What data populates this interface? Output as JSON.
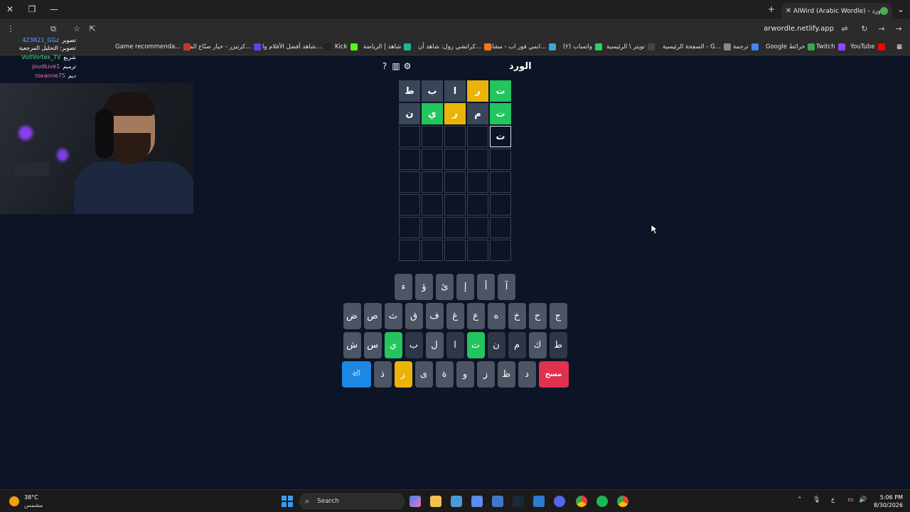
{
  "browser": {
    "tab_title": "AlWird (Arabic Wordle) - الورد",
    "url": "arwordle.netlify.app",
    "profile_initial": "E",
    "bookmarks": [
      {
        "label": "YouTube",
        "color": "#ff0000"
      },
      {
        "label": "Twitch",
        "color": "#9146ff"
      },
      {
        "label": "Google خرائط",
        "color": "#34a853"
      },
      {
        "label": "ترجمة",
        "color": "#4285f4"
      },
      {
        "label": "الصفحة الرئيسية - G...",
        "color": "#888888"
      },
      {
        "label": "تويتر \\ الرئيسية",
        "color": "#444444"
      },
      {
        "label": "(٢) واتساب",
        "color": "#25d366"
      },
      {
        "label": "انمي فور اب - مشاهد...",
        "color": "#3ba9d9"
      },
      {
        "label": "كرانشي رول: شاهد أن...",
        "color": "#f47521"
      },
      {
        "label": "شاهد | الرياضة",
        "color": "#1fb59b"
      },
      {
        "label": "Kick",
        "color": "#53fc18"
      },
      {
        "label": "شاهد أفضل الأفلام وا...",
        "color": "#222222"
      },
      {
        "label": "كرتيزر - خيار صنّاع الم...",
        "color": "#6a3de8"
      },
      {
        "label": "Game recommenda...",
        "color": "#c0392b"
      }
    ]
  },
  "chat": [
    {
      "user": "4Z3R21_GGz",
      "msg": "تصوير",
      "color": "#6aa0ff"
    },
    {
      "user": "",
      "msg": "تصوير: التحليل المرجعية",
      "color": "#ffffff"
    },
    {
      "user": "VoltVortex_TV",
      "msg": "شريع",
      "color": "#4ade80"
    },
    {
      "user": "joudluve1",
      "msg": "ترميم",
      "color": "#f472b6"
    },
    {
      "user": "roxanne75",
      "msg": "ديم",
      "color": "#f472b6"
    }
  ],
  "game": {
    "title": "الورد",
    "grid": [
      [
        {
          "l": "ت",
          "s": "green"
        },
        {
          "l": "ر",
          "s": "yellow"
        },
        {
          "l": "ا",
          "s": "gray"
        },
        {
          "l": "ب",
          "s": "gray"
        },
        {
          "l": "ط",
          "s": "gray"
        }
      ],
      [
        {
          "l": "ت",
          "s": "green"
        },
        {
          "l": "م",
          "s": "gray"
        },
        {
          "l": "ر",
          "s": "yellow"
        },
        {
          "l": "ي",
          "s": "green"
        },
        {
          "l": "ن",
          "s": "gray"
        }
      ],
      [
        {
          "l": "ت",
          "s": "active"
        },
        {
          "l": "",
          "s": "empty"
        },
        {
          "l": "",
          "s": "empty"
        },
        {
          "l": "",
          "s": "empty"
        },
        {
          "l": "",
          "s": "empty"
        }
      ],
      [
        {
          "l": "",
          "s": "empty"
        },
        {
          "l": "",
          "s": "empty"
        },
        {
          "l": "",
          "s": "empty"
        },
        {
          "l": "",
          "s": "empty"
        },
        {
          "l": "",
          "s": "empty"
        }
      ],
      [
        {
          "l": "",
          "s": "empty"
        },
        {
          "l": "",
          "s": "empty"
        },
        {
          "l": "",
          "s": "empty"
        },
        {
          "l": "",
          "s": "empty"
        },
        {
          "l": "",
          "s": "empty"
        }
      ],
      [
        {
          "l": "",
          "s": "empty"
        },
        {
          "l": "",
          "s": "empty"
        },
        {
          "l": "",
          "s": "empty"
        },
        {
          "l": "",
          "s": "empty"
        },
        {
          "l": "",
          "s": "empty"
        }
      ],
      [
        {
          "l": "",
          "s": "empty"
        },
        {
          "l": "",
          "s": "empty"
        },
        {
          "l": "",
          "s": "empty"
        },
        {
          "l": "",
          "s": "empty"
        },
        {
          "l": "",
          "s": "empty"
        }
      ],
      [
        {
          "l": "",
          "s": "empty"
        },
        {
          "l": "",
          "s": "empty"
        },
        {
          "l": "",
          "s": "empty"
        },
        {
          "l": "",
          "s": "empty"
        },
        {
          "l": "",
          "s": "empty"
        }
      ]
    ],
    "keyboard": [
      [
        {
          "l": "آ",
          "s": "normal"
        },
        {
          "l": "أ",
          "s": "normal"
        },
        {
          "l": "إ",
          "s": "normal"
        },
        {
          "l": "ئ",
          "s": "normal"
        },
        {
          "l": "ؤ",
          "s": "normal"
        },
        {
          "l": "ء",
          "s": "normal"
        }
      ],
      [
        {
          "l": "ج",
          "s": "normal"
        },
        {
          "l": "ح",
          "s": "normal"
        },
        {
          "l": "خ",
          "s": "normal"
        },
        {
          "l": "ه",
          "s": "normal"
        },
        {
          "l": "ع",
          "s": "normal"
        },
        {
          "l": "غ",
          "s": "normal"
        },
        {
          "l": "ف",
          "s": "normal"
        },
        {
          "l": "ق",
          "s": "normal"
        },
        {
          "l": "ث",
          "s": "normal"
        },
        {
          "l": "ص",
          "s": "normal"
        },
        {
          "l": "ض",
          "s": "normal"
        }
      ],
      [
        {
          "l": "ط",
          "s": "dark"
        },
        {
          "l": "ك",
          "s": "normal"
        },
        {
          "l": "م",
          "s": "dark"
        },
        {
          "l": "ن",
          "s": "dark"
        },
        {
          "l": "ت",
          "s": "green"
        },
        {
          "l": "ا",
          "s": "dark"
        },
        {
          "l": "ل",
          "s": "normal"
        },
        {
          "l": "ب",
          "s": "dark"
        },
        {
          "l": "ي",
          "s": "green"
        },
        {
          "l": "س",
          "s": "normal"
        },
        {
          "l": "ش",
          "s": "normal"
        }
      ],
      [
        {
          "l": "مسح",
          "s": "del"
        },
        {
          "l": "د",
          "s": "normal"
        },
        {
          "l": "ظ",
          "s": "normal"
        },
        {
          "l": "ز",
          "s": "normal"
        },
        {
          "l": "و",
          "s": "normal"
        },
        {
          "l": "ة",
          "s": "normal"
        },
        {
          "l": "ى",
          "s": "normal"
        },
        {
          "l": "ر",
          "s": "yellow"
        },
        {
          "l": "ذ",
          "s": "normal"
        },
        {
          "l": "⏎",
          "s": "enter"
        }
      ]
    ]
  },
  "taskbar": {
    "temp": "38°C",
    "weather": "مشمس",
    "search": "Search",
    "lang": "ع",
    "time": "5:06 PM",
    "date": "8/30/2026"
  },
  "colors": {
    "green": "#22c55e",
    "yellow": "#eab308",
    "gray": "#3a4658",
    "background": "#0c1425",
    "enter": "#1d87e4",
    "delete": "#e0314f"
  }
}
